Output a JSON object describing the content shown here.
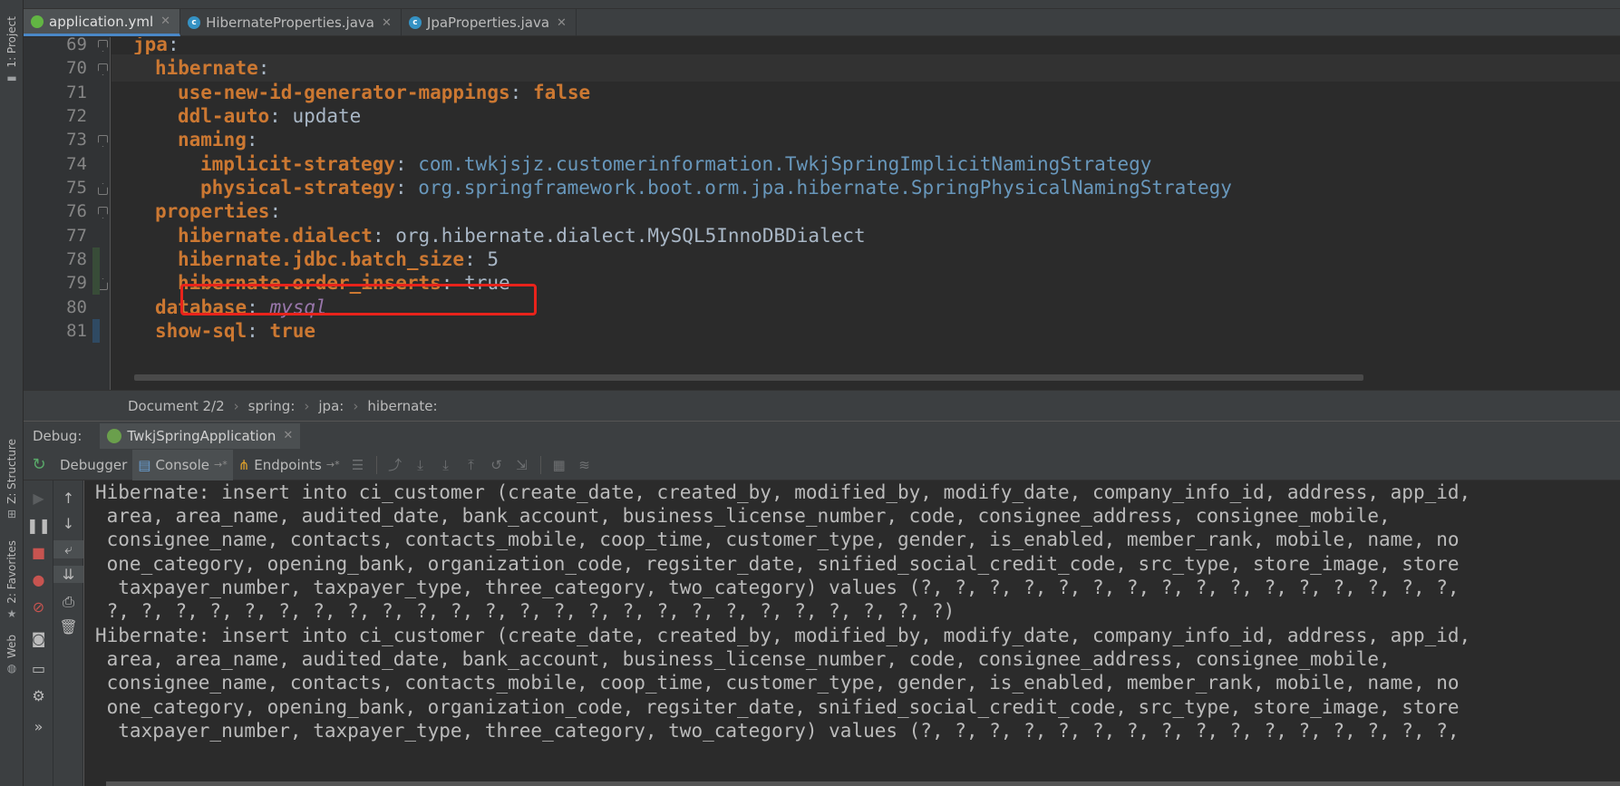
{
  "editor_tabs": [
    {
      "name": "application.yml",
      "icon": "yaml-file-icon",
      "active": true
    },
    {
      "name": "HibernateProperties.java",
      "icon": "java-class-icon",
      "active": false
    },
    {
      "name": "JpaProperties.java",
      "icon": "java-class-icon",
      "active": false
    }
  ],
  "left_stripe": {
    "project": "1: Project",
    "structure": "Z: Structure",
    "favorites": "2: Favorites",
    "web": "Web"
  },
  "editor": {
    "line_numbers": [
      "69",
      "70",
      "71",
      "72",
      "73",
      "74",
      "75",
      "76",
      "77",
      "78",
      "79",
      "80",
      "81"
    ],
    "lines": [
      {
        "key": "jpa",
        "sep": ":",
        "value": ""
      },
      {
        "key": "hibernate",
        "sep": ":",
        "value": ""
      },
      {
        "key": "use-new-id-generator-mappings",
        "sep": ": ",
        "value": "false"
      },
      {
        "key": "ddl-auto",
        "sep": ": ",
        "value": "update"
      },
      {
        "key": "naming",
        "sep": ":",
        "value": ""
      },
      {
        "key": "implicit-strategy",
        "sep": ": ",
        "value": "com.twkjsjz.customerinformation.TwkjSpringImplicitNamingStrategy"
      },
      {
        "key": "physical-strategy",
        "sep": ": ",
        "value": "org.springframework.boot.orm.jpa.hibernate.SpringPhysicalNamingStrategy"
      },
      {
        "key": "properties",
        "sep": ":",
        "value": ""
      },
      {
        "key": "hibernate.dialect",
        "sep": ": ",
        "value": "org.hibernate.dialect.MySQL5InnoDBDialect"
      },
      {
        "key": "hibernate.jdbc.batch_size",
        "sep": ": ",
        "value": "5"
      },
      {
        "key": "hibernate.order_inserts",
        "sep": ": ",
        "value": "true"
      },
      {
        "key": "database",
        "sep": ": ",
        "value": "mysql"
      },
      {
        "key": "show-sql",
        "sep": ": ",
        "value": "true"
      }
    ]
  },
  "breadcrumb": {
    "document": "Document 2/2",
    "items": [
      "spring:",
      "jpa:",
      "hibernate:"
    ]
  },
  "debug": {
    "title": "Debug:",
    "session": "TwkjSpringApplication",
    "tabs": [
      "Debugger",
      "Console",
      "Endpoints"
    ],
    "console_lines": [
      "Hibernate: insert into ci_customer (create_date, created_by, modified_by, modify_date, company_info_id, address, app_id,",
      " area, area_name, audited_date, bank_account, business_license_number, code, consignee_address, consignee_mobile,",
      " consignee_name, contacts, contacts_mobile, coop_time, customer_type, gender, is_enabled, member_rank, mobile, name, no",
      " one_category, opening_bank, organization_code, regsiter_date, snified_social_credit_code, src_type, store_image, store",
      "  taxpayer_number, taxpayer_type, three_category, two_category) values (?, ?, ?, ?, ?, ?, ?, ?, ?, ?, ?, ?, ?, ?, ?, ?,",
      " ?, ?, ?, ?, ?, ?, ?, ?, ?, ?, ?, ?, ?, ?, ?, ?, ?, ?, ?, ?, ?, ?, ?, ?, ?)",
      "Hibernate: insert into ci_customer (create_date, created_by, modified_by, modify_date, company_info_id, address, app_id,",
      " area, area_name, audited_date, bank_account, business_license_number, code, consignee_address, consignee_mobile,",
      " consignee_name, contacts, contacts_mobile, coop_time, customer_type, gender, is_enabled, member_rank, mobile, name, no",
      " one_category, opening_bank, organization_code, regsiter_date, snified_social_credit_code, src_type, store_image, store",
      "  taxpayer_number, taxpayer_type, three_category, two_category) values (?, ?, ?, ?, ?, ?, ?, ?, ?, ?, ?, ?, ?, ?, ?, ?,"
    ]
  },
  "colors": {
    "highlight_box": "#e8231b",
    "yaml_key": "#cc7832",
    "yaml_class_value": "#6897bb",
    "yaml_enum_value": "#9876aa",
    "active_tab_underline": "#4a88c7"
  }
}
